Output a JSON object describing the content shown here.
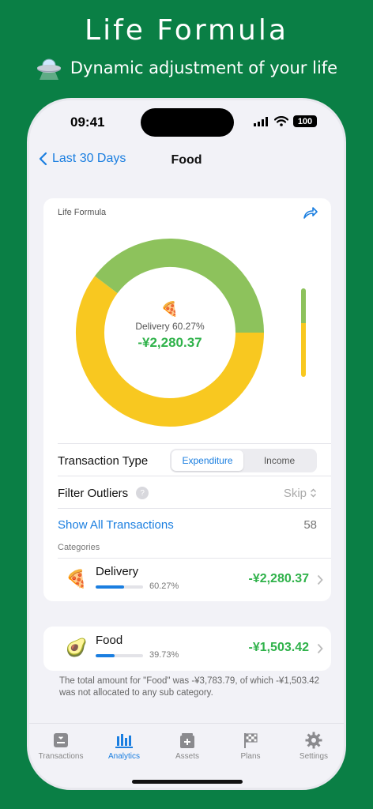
{
  "promo": {
    "title": "Life Formula",
    "subtitle": "Dynamic adjustment of your life"
  },
  "status_bar": {
    "time": "09:41",
    "battery": "100"
  },
  "nav": {
    "back_label": "Last 30 Days",
    "title": "Food"
  },
  "card": {
    "heading": "Life Formula",
    "center_emoji": "🍕",
    "center_label": "Delivery 60.27%",
    "center_amount": "-¥2,280.37"
  },
  "chart_data": {
    "type": "pie",
    "series": [
      {
        "name": "Delivery",
        "share": 0.6027,
        "color": "#f8c820"
      },
      {
        "name": "Unallocated",
        "share": 0.3973,
        "color": "#8dc25c"
      }
    ]
  },
  "transaction_type": {
    "label": "Transaction Type",
    "options": [
      "Expenditure",
      "Income"
    ],
    "selected": "Expenditure"
  },
  "filter_outliers": {
    "label": "Filter Outliers",
    "help": "?",
    "value": "Skip"
  },
  "show_all": {
    "label": "Show All Transactions",
    "count": "58"
  },
  "categories_label": "Categories",
  "categories": [
    {
      "emoji": "🍕",
      "name": "Delivery",
      "percent": "60.27%",
      "fraction": 0.6027,
      "amount": "-¥2,280.37"
    }
  ],
  "parent": {
    "emoji": "🥑",
    "name": "Food",
    "percent": "39.73%",
    "fraction": 0.3973,
    "amount": "-¥1,503.42"
  },
  "footnote": "The total amount for \"Food\" was -¥3,783.79, of which -¥1,503.42 was not allocated to any sub category.",
  "tabs": [
    {
      "label": "Transactions",
      "icon": "transactions-icon"
    },
    {
      "label": "Analytics",
      "icon": "analytics-icon",
      "active": true
    },
    {
      "label": "Assets",
      "icon": "assets-icon"
    },
    {
      "label": "Plans",
      "icon": "plans-flag-icon"
    },
    {
      "label": "Settings",
      "icon": "gear-icon"
    }
  ],
  "colors": {
    "accent": "#1a7ee0",
    "amount": "#2fb24a",
    "background": "#0a7f45"
  }
}
